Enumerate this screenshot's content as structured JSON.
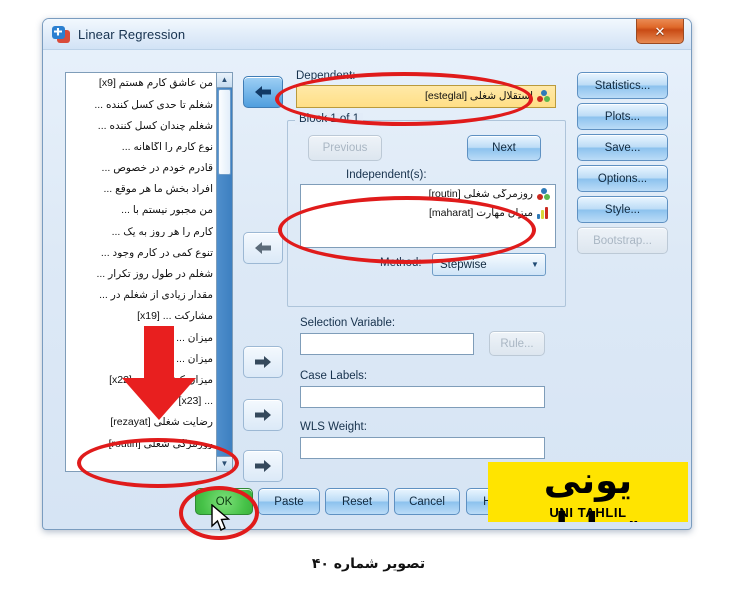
{
  "window": {
    "title": "Linear Regression",
    "app_icon": "spss-icon",
    "close_label": "✕"
  },
  "variable_list": {
    "items": [
      {
        "label": "من عاشق کارم هستم [x9]",
        "icon": "scale-icon"
      },
      {
        "label": "شغلم تا حدی کسل کننده ...",
        "icon": "scale-icon"
      },
      {
        "label": "شغلم چندان کسل کننده ...",
        "icon": "ruler-icon"
      },
      {
        "label": "نوع کارم را آگاهانه ...",
        "icon": "scale-icon"
      },
      {
        "label": "قادرم خودم در خصوص ...",
        "icon": "scale-icon"
      },
      {
        "label": "افراد بخش ما هر موقع ...",
        "icon": "scale-icon"
      },
      {
        "label": "من مجبور نیستم با ...",
        "icon": "scale-icon"
      },
      {
        "label": "کارم را هر روز به یک ...",
        "icon": "scale-icon"
      },
      {
        "label": "تنوع کمی در کارم وجود ...",
        "icon": "scale-icon"
      },
      {
        "label": "شغلم در طول روز تکرار ...",
        "icon": "scale-icon"
      },
      {
        "label": "مقدار زیادی از شغلم در ...",
        "icon": "scale-icon"
      },
      {
        "label": "مشارکت ... [x19]",
        "icon": "scale-icon"
      },
      {
        "label": "میزان ... [x20]",
        "icon": "scale-icon"
      },
      {
        "label": "میزان ... [x21]",
        "icon": "scale-icon"
      },
      {
        "label": "میزان کیفیت تولید [x22]",
        "icon": "scale-icon"
      },
      {
        "label": "... [x23]",
        "icon": "ruler-icon"
      },
      {
        "label": "رضایت شغلی [rezayat]",
        "icon": "nominal-icon"
      },
      {
        "label": "روزمرگی شغلی [routin]",
        "icon": "nominal-icon"
      }
    ],
    "scroll_up": "▲",
    "scroll_down": "▼"
  },
  "dependent": {
    "label": "Dependent:",
    "value": "استقلال شغلی [esteglal]",
    "icon": "nominal-icon",
    "highlight_color": "#ffdf86"
  },
  "block": {
    "title": "Block 1 of 1",
    "previous_label": "Previous",
    "next_label": "Next"
  },
  "independents": {
    "label": "Independent(s):",
    "items": [
      {
        "label": "روزمرگی شغلی [routin]",
        "icon": "nominal-icon"
      },
      {
        "label": "میزان مهارت [maharat]",
        "icon": "scale-icon"
      }
    ]
  },
  "method": {
    "label": "Method:",
    "value": "Stepwise",
    "arrow": "▼"
  },
  "selection_variable": {
    "label": "Selection Variable:",
    "value": "",
    "rule_label": "Rule..."
  },
  "case_labels": {
    "label": "Case Labels:",
    "value": ""
  },
  "wls_weight": {
    "label": "WLS Weight:",
    "value": ""
  },
  "side_buttons": [
    {
      "label": "Statistics...",
      "enabled": true
    },
    {
      "label": "Plots...",
      "enabled": true
    },
    {
      "label": "Save...",
      "enabled": true
    },
    {
      "label": "Options...",
      "enabled": true
    },
    {
      "label": "Style...",
      "enabled": true
    },
    {
      "label": "Bootstrap...",
      "enabled": false
    }
  ],
  "bottom_buttons": [
    {
      "label": "OK",
      "state": "highlighted"
    },
    {
      "label": "Paste",
      "state": "normal"
    },
    {
      "label": "Reset",
      "state": "normal"
    },
    {
      "label": "Cancel",
      "state": "normal"
    },
    {
      "label": "Help",
      "state": "normal"
    }
  ],
  "watermark": {
    "farsi": "یونی تحلیل",
    "english": "UNI TAHLIL",
    "background": "#ffe400"
  },
  "caption": {
    "text": "تصویر شماره ۴۰"
  },
  "annotations": {
    "highlight_color": "#e01b1b",
    "arrow_color": "#e01b1b"
  }
}
